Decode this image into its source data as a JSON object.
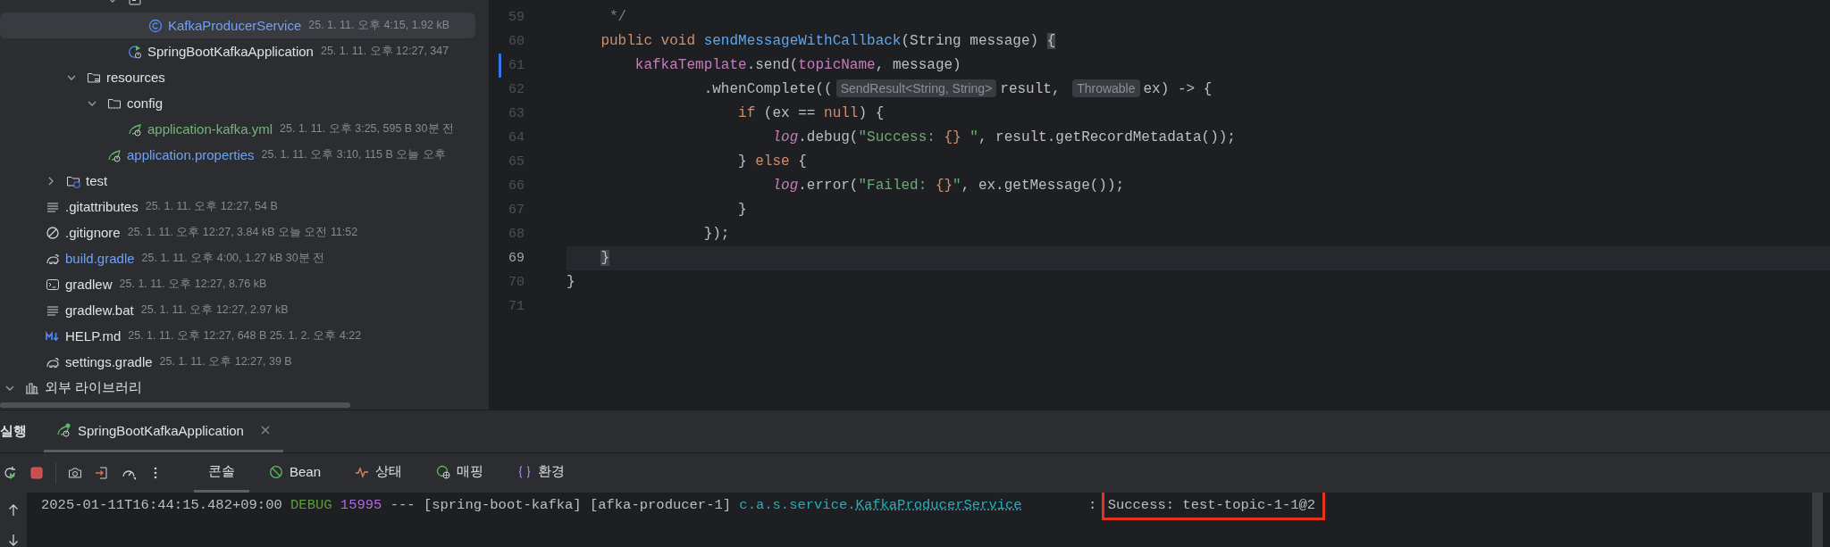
{
  "project_tree": {
    "items": [
      {
        "children": [
          {
            "children": [
              {
                "children": [
                  {
                    "children": [
                      {
                        "children": [
                          {
                            "kind": "package",
                            "expanded": true,
                            "children": [
                              {
                                "label": "KafkaProducerService",
                                "kind": "class",
                                "color": "#6fa1f2",
                                "selected": true,
                                "info": "25. 1. 11. 오후 4:15, 1.92 kB"
                              }
                            ]
                          },
                          {
                            "label": "SpringBootKafkaApplication",
                            "kind": "spring-app",
                            "color": "#dfe1e5",
                            "selected": false,
                            "info": "25. 1. 11. 오후 12:27, 347"
                          }
                        ]
                      }
                    ]
                  },
                  {
                    "label": "resources",
                    "kind": "resources-folder",
                    "expanded": true,
                    "selected": false,
                    "children": [
                      {
                        "label": "config",
                        "kind": "folder",
                        "expanded": true,
                        "selected": false,
                        "children": [
                          {
                            "label": "application-kafka.yml",
                            "kind": "spring-config",
                            "color": "#73b478",
                            "selected": false,
                            "info": "25. 1. 11. 오후 3:25, 595 B 30분 전"
                          }
                        ]
                      },
                      {
                        "label": "application.properties",
                        "kind": "spring-config",
                        "color": "#6fa1f2",
                        "selected": false,
                        "info": "25. 1. 11. 오후 3:10, 115 B 오늘 오후"
                      }
                    ]
                  }
                ]
              },
              {
                "label": "test",
                "kind": "test-folder",
                "expanded": false,
                "selected": false
              }
            ]
          },
          {
            "label": ".gitattributes",
            "kind": "text-file",
            "color": "#dfe1e5",
            "selected": false,
            "info": "25. 1. 11. 오후 12:27, 54 B"
          },
          {
            "label": ".gitignore",
            "kind": "ignore-file",
            "color": "#dfe1e5",
            "selected": false,
            "info": "25. 1. 11. 오후 12:27, 3.84 kB 오늘 오전 11:52"
          },
          {
            "label": "build.gradle",
            "kind": "gradle",
            "color": "#6fa1f2",
            "selected": false,
            "info": "25. 1. 11. 오후 4:00, 1.27 kB 30분 전"
          },
          {
            "label": "gradlew",
            "kind": "terminal",
            "color": "#dfe1e5",
            "selected": false,
            "info": "25. 1. 11. 오후 12:27, 8.76 kB"
          },
          {
            "label": "gradlew.bat",
            "kind": "text-file",
            "color": "#dfe1e5",
            "selected": false,
            "info": "25. 1. 11. 오후 12:27, 2.97 kB"
          },
          {
            "label": "HELP.md",
            "kind": "markdown",
            "color": "#dfe1e5",
            "selected": false,
            "info": "25. 1. 11. 오후 12:27, 648 B 25. 1. 2. 오후 4:22"
          },
          {
            "label": "settings.gradle",
            "kind": "gradle",
            "color": "#dfe1e5",
            "selected": false,
            "info": "25. 1. 11. 오후 12:27, 39 B"
          }
        ]
      },
      {
        "label": "외부 라이브러리",
        "kind": "library",
        "expanded": true,
        "selected": false
      }
    ]
  },
  "editor": {
    "lines": [
      {
        "number": "59",
        "current": false,
        "changed": false,
        "tokens": [
          {
            "text": "     */",
            "kind": "comment"
          }
        ]
      },
      {
        "number": "60",
        "current": false,
        "changed": false,
        "tokens": [
          {
            "text": "    public void ",
            "kind": "keyword"
          },
          {
            "text": "sendMessageWithCallback",
            "kind": "declaration"
          },
          {
            "text": "(String message) ",
            "kind": "plain"
          },
          {
            "text": "{",
            "kind": "brace-match"
          }
        ]
      },
      {
        "number": "61",
        "current": false,
        "changed": true,
        "tokens": [
          {
            "text": "        kafkaTemplate",
            "kind": "field"
          },
          {
            "text": ".send(",
            "kind": "plain"
          },
          {
            "text": "topicName",
            "kind": "field"
          },
          {
            "text": ", message)",
            "kind": "plain"
          }
        ]
      },
      {
        "number": "62",
        "current": false,
        "changed": false,
        "tokens": [
          {
            "text": "                .whenComplete((",
            "kind": "plain"
          },
          {
            "text": "SendResult<String, String>",
            "kind": "hint"
          },
          {
            "text": "result, ",
            "kind": "plain"
          },
          {
            "text": "Throwable",
            "kind": "hint"
          },
          {
            "text": "ex) -> {",
            "kind": "plain"
          }
        ]
      },
      {
        "number": "63",
        "current": false,
        "changed": false,
        "tokens": [
          {
            "text": "                    if",
            "kind": "keyword"
          },
          {
            "text": " (ex == ",
            "kind": "plain"
          },
          {
            "text": "null",
            "kind": "keyword"
          },
          {
            "text": ") {",
            "kind": "plain"
          }
        ]
      },
      {
        "number": "64",
        "current": false,
        "changed": false,
        "tokens": [
          {
            "text": "                        log",
            "kind": "static-field"
          },
          {
            "text": ".debug(",
            "kind": "plain"
          },
          {
            "text": "\"Success: ",
            "kind": "string"
          },
          {
            "text": "{}",
            "kind": "keyword"
          },
          {
            "text": " \"",
            "kind": "string"
          },
          {
            "text": ", result.getRecordMetadata());",
            "kind": "plain"
          }
        ]
      },
      {
        "number": "65",
        "current": false,
        "changed": false,
        "tokens": [
          {
            "text": "                    } ",
            "kind": "plain"
          },
          {
            "text": "else",
            "kind": "keyword"
          },
          {
            "text": " {",
            "kind": "plain"
          }
        ]
      },
      {
        "number": "66",
        "current": false,
        "changed": false,
        "tokens": [
          {
            "text": "                        log",
            "kind": "static-field"
          },
          {
            "text": ".error(",
            "kind": "plain"
          },
          {
            "text": "\"Failed: ",
            "kind": "string"
          },
          {
            "text": "{}",
            "kind": "keyword"
          },
          {
            "text": "\"",
            "kind": "string"
          },
          {
            "text": ", ex.getMessage());",
            "kind": "plain"
          }
        ]
      },
      {
        "number": "67",
        "current": false,
        "changed": false,
        "tokens": [
          {
            "text": "                    }",
            "kind": "plain"
          }
        ]
      },
      {
        "number": "68",
        "current": false,
        "changed": false,
        "tokens": [
          {
            "text": "                });",
            "kind": "plain"
          }
        ]
      },
      {
        "number": "69",
        "current": true,
        "changed": false,
        "tokens": [
          {
            "text": "    }",
            "kind": "brace-match"
          }
        ]
      },
      {
        "number": "70",
        "current": false,
        "changed": false,
        "tokens": [
          {
            "text": "}",
            "kind": "plain"
          }
        ]
      },
      {
        "number": "71",
        "current": false,
        "changed": false
      }
    ]
  },
  "run_panel": {
    "title": "실행",
    "tabs": [
      {
        "label": "SpringBootKafkaApplication",
        "selected": true
      }
    ],
    "toolbar": [
      {
        "kind": "rerun"
      },
      {
        "kind": "stop"
      },
      {
        "kind": "divider"
      },
      {
        "kind": "snapshot"
      },
      {
        "kind": "exit"
      },
      {
        "kind": "gauge"
      },
      {
        "kind": "more"
      }
    ],
    "views": [
      {
        "label": "콘솔",
        "kind": "console",
        "selected": true
      },
      {
        "label": "Bean",
        "kind": "beans",
        "selected": false
      },
      {
        "label": "상태",
        "kind": "health",
        "selected": false
      },
      {
        "label": "매핑",
        "kind": "mappings",
        "selected": false
      },
      {
        "label": "환경",
        "kind": "environment",
        "selected": false
      }
    ],
    "console": {
      "lines": [
        {
          "tokens": [
            {
              "text": "2025-01-11T16:44:15.482+09:00 ",
              "kind": "plain"
            },
            {
              "text": "DEBUG ",
              "kind": "level"
            },
            {
              "text": "15995",
              "kind": "pid"
            },
            {
              "text": " --- [spring-boot-kafka] [afka-producer-1] ",
              "kind": "plain"
            },
            {
              "text": "c.a.s.service.",
              "kind": "logger"
            },
            {
              "text": "KafkaProducerService",
              "kind": "logger-link"
            },
            {
              "text": "        : ",
              "kind": "plain"
            },
            {
              "text": "Success: test-topic-1-1@2",
              "kind": "plain",
              "boxed": true
            }
          ]
        }
      ]
    }
  }
}
